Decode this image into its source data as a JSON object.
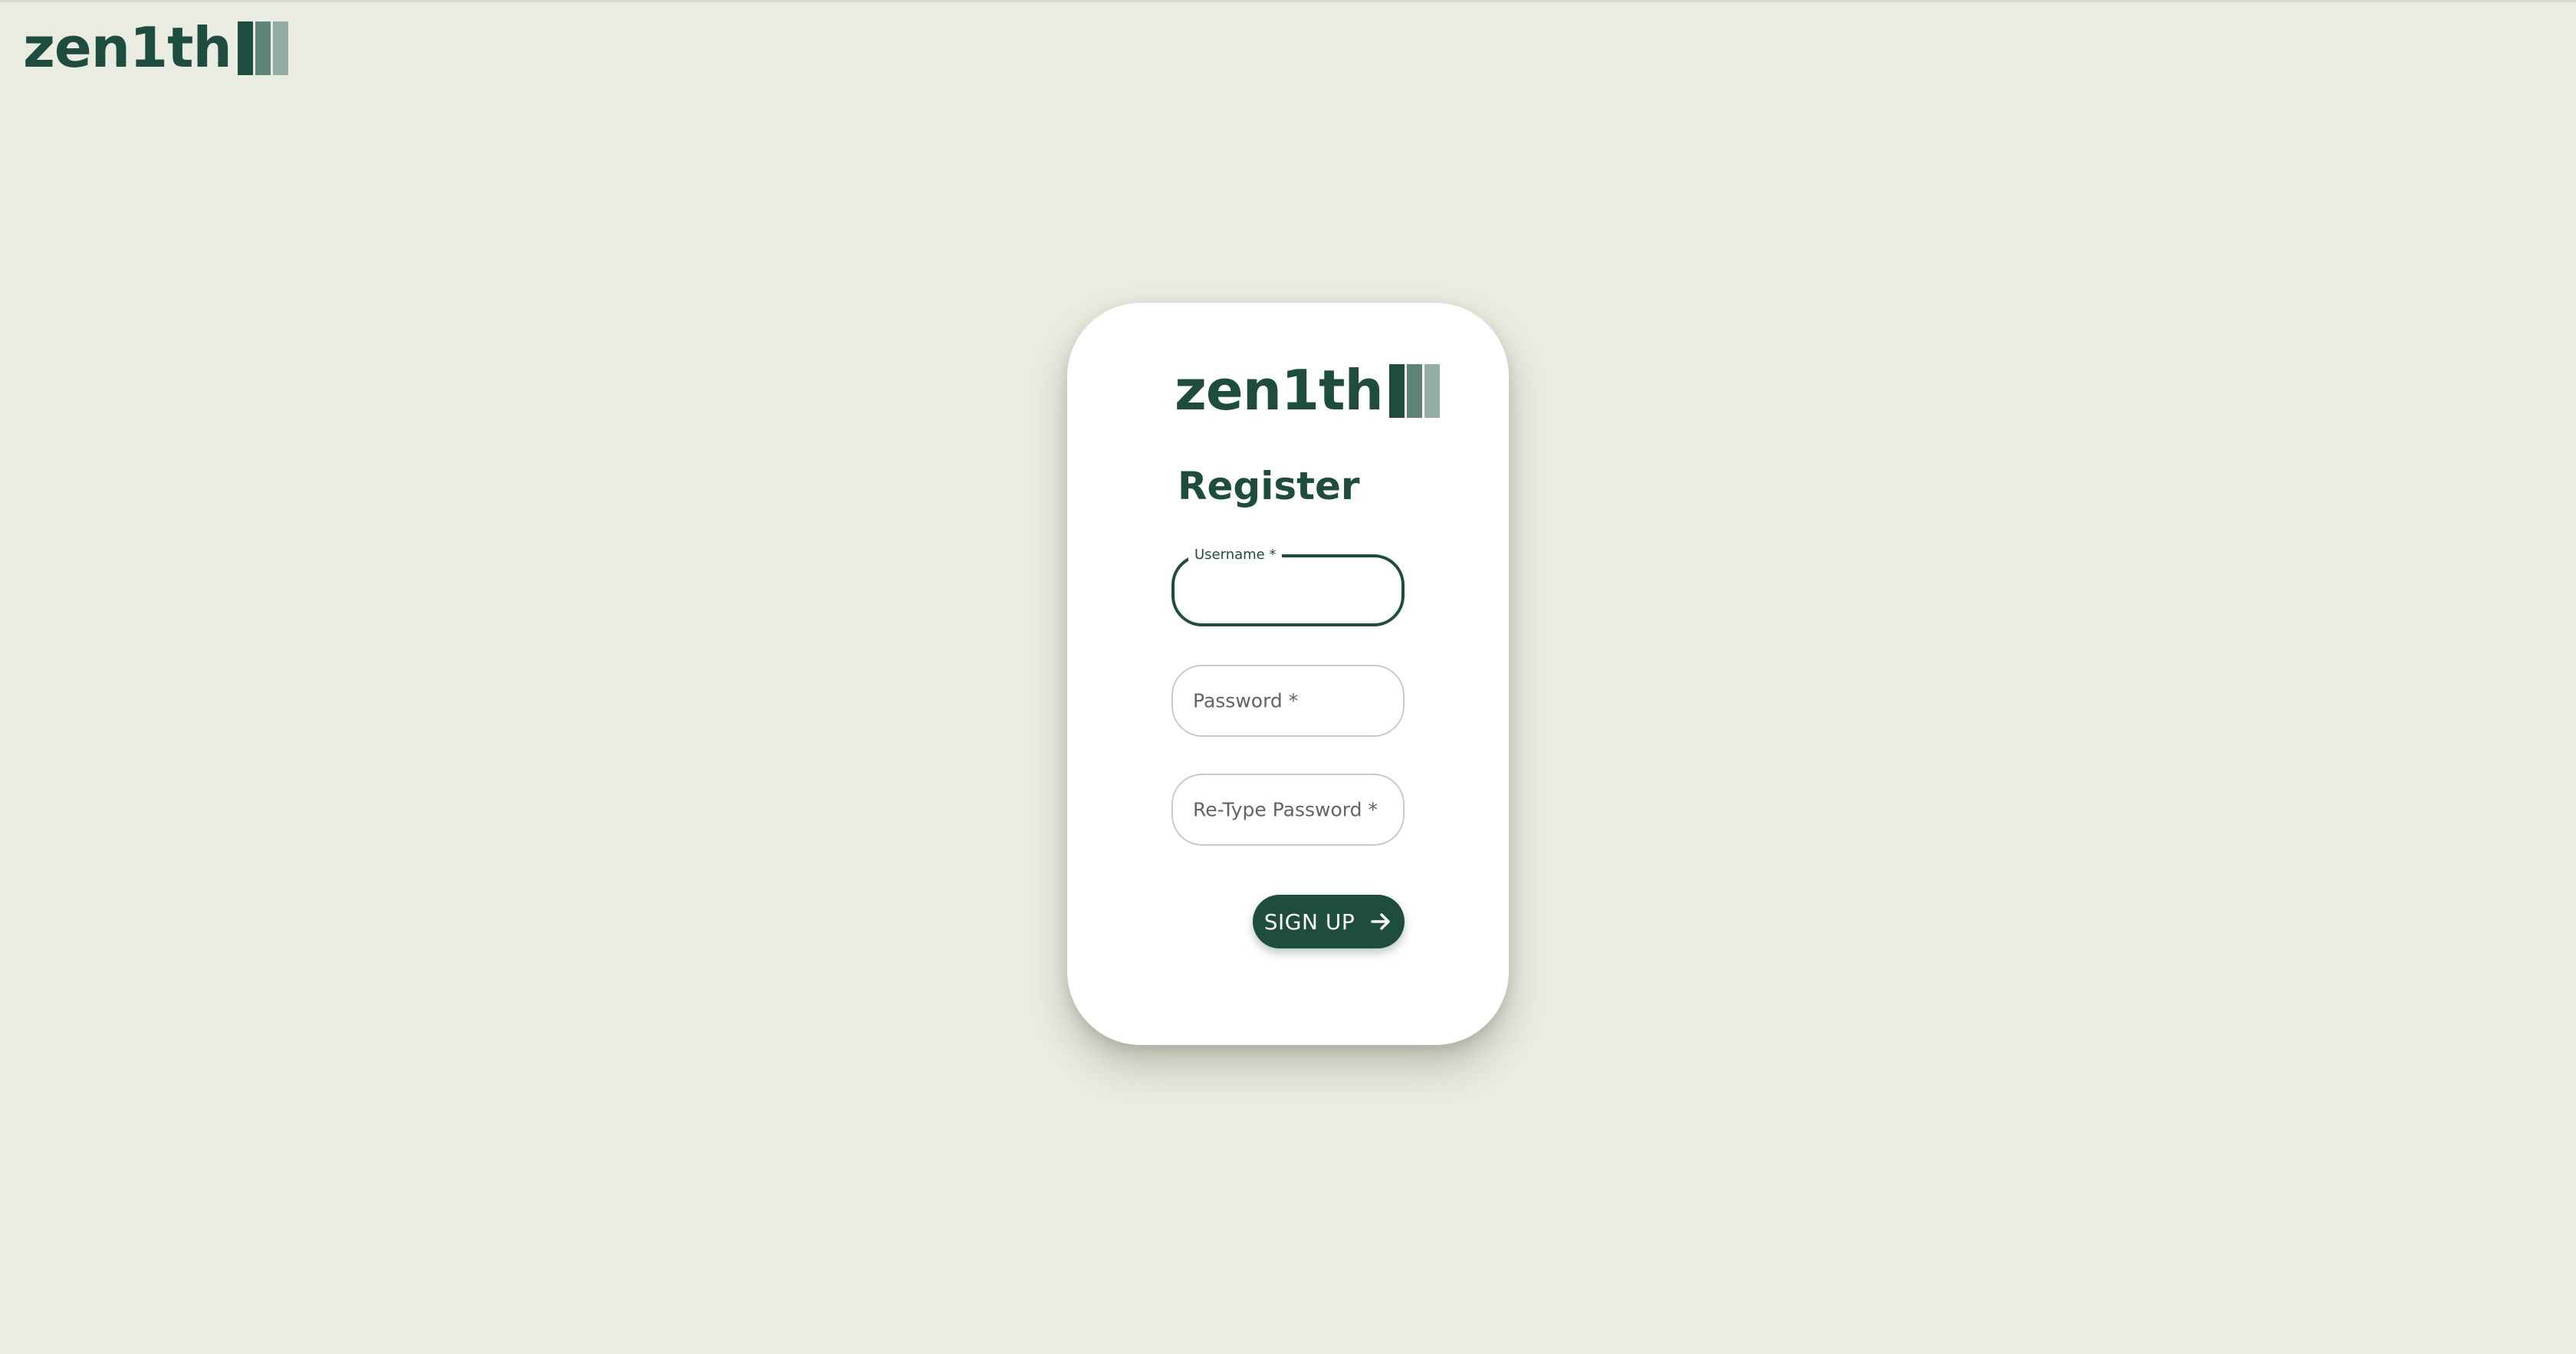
{
  "header": {
    "logo_text": "zen1th"
  },
  "card": {
    "logo_text": "zen1th",
    "title": "Register"
  },
  "form": {
    "username": {
      "label": "Username *",
      "value": ""
    },
    "password": {
      "placeholder": "Password *",
      "value": ""
    },
    "retype_password": {
      "placeholder": "Re-Type Password *",
      "value": ""
    },
    "submit_label": "SIGN UP",
    "submit_icon": "arrow-right-icon"
  },
  "colors": {
    "background": "#eaece1",
    "brand": "#1e4d40",
    "brand_mid": "#5e8377",
    "brand_light": "#94ada4",
    "card": "#ffffff"
  }
}
